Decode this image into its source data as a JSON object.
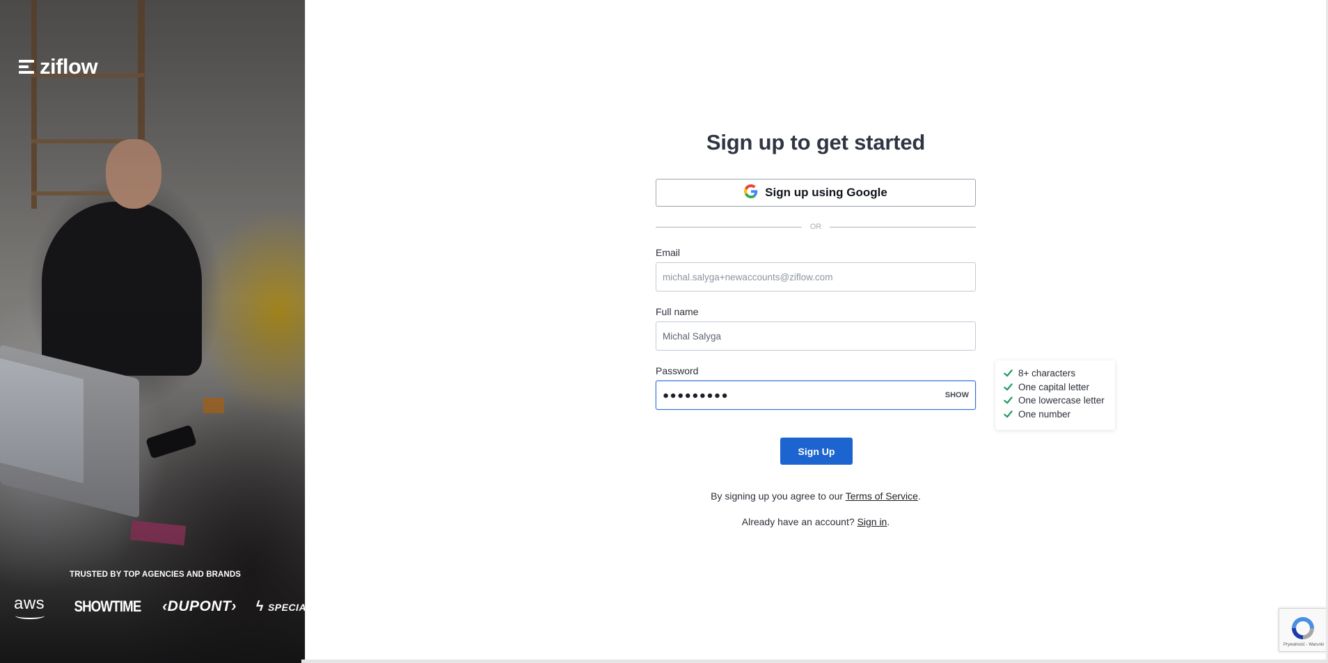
{
  "brand": {
    "name": "ziflow"
  },
  "hero": {
    "trusted_label": "TRUSTED BY TOP AGENCIES AND BRANDS",
    "logos": {
      "aws": "aws",
      "showtime": "SHOWTIME",
      "dupont": "‹DUPONT›",
      "specialized": "SPECIALIZED"
    }
  },
  "form": {
    "title": "Sign up to get started",
    "google_button": "Sign up using Google",
    "or_label": "OR",
    "email": {
      "label": "Email",
      "value": "michal.salyga+newaccounts@ziflow.com"
    },
    "full_name": {
      "label": "Full name",
      "value": "Michal Salyga"
    },
    "password": {
      "label": "Password",
      "masked_value": "●●●●●●●●●",
      "show_label": "SHOW"
    },
    "password_rules": [
      "8+ characters",
      "One capital letter",
      "One lowercase letter",
      "One number"
    ],
    "submit_label": "Sign Up",
    "terms": {
      "prefix": "By signing up you agree to our",
      "link": "Terms of Service",
      "suffix": "."
    },
    "signin": {
      "prefix": "Already have an account?",
      "link": "Sign in",
      "suffix": "."
    }
  },
  "recaptcha": {
    "text": "Prywatność - Warunki"
  },
  "colors": {
    "primary": "#1c64cf",
    "focus_border": "#2e6dd4",
    "check": "#1a9a5c",
    "title": "#2f3542"
  },
  "icons": {
    "google": "google-g-icon",
    "check": "check-icon",
    "recaptcha": "recaptcha-icon",
    "brand": "ziflow-mark-icon"
  }
}
